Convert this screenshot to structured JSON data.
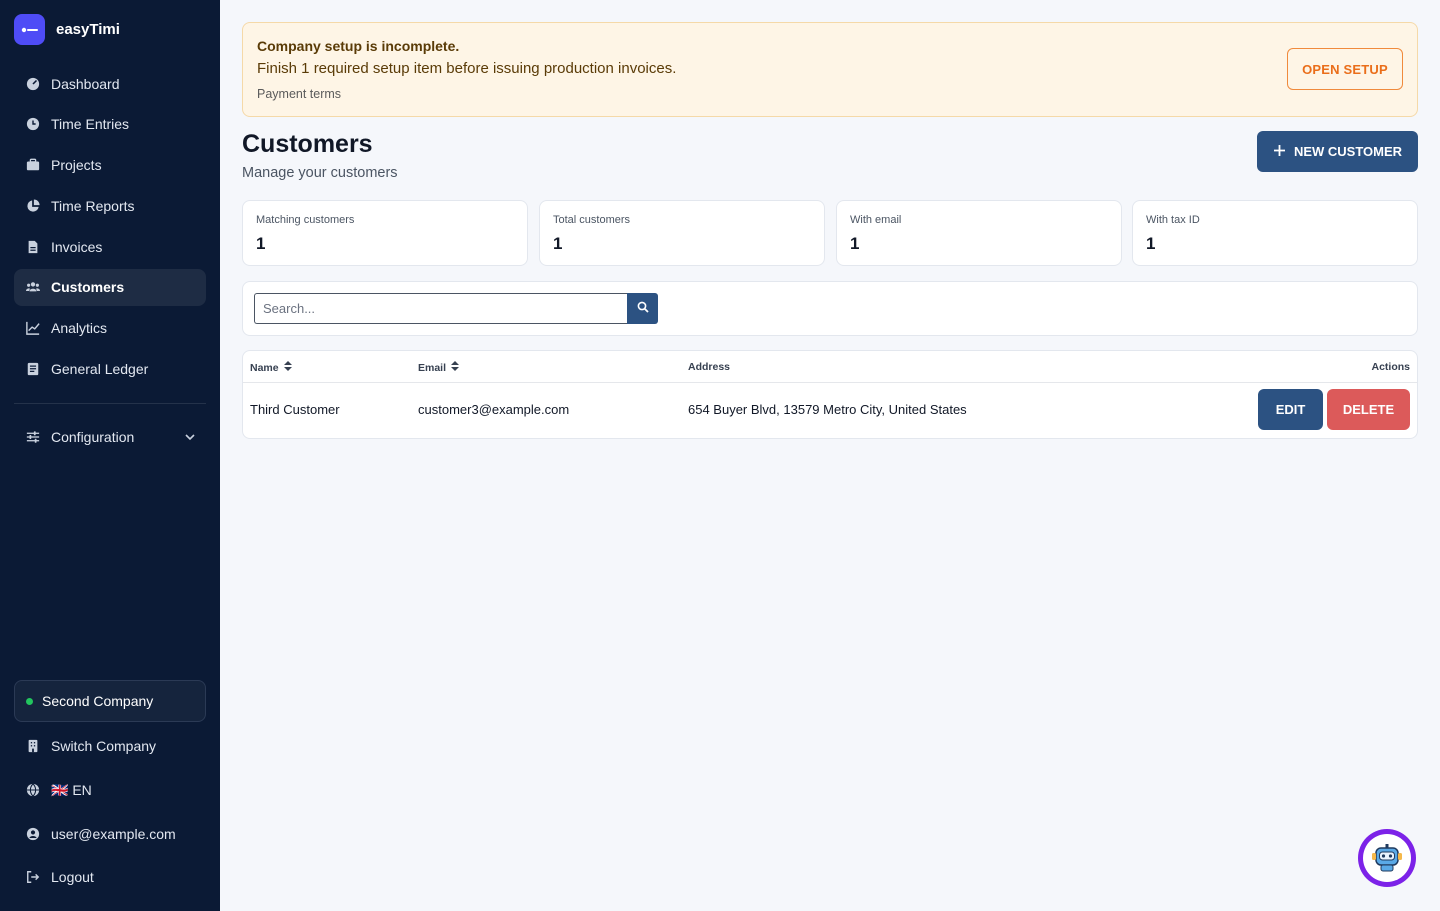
{
  "brand": {
    "name": "easyTimi"
  },
  "nav": {
    "items": [
      {
        "label": "Dashboard",
        "icon": "dashboard-icon",
        "active": false
      },
      {
        "label": "Time Entries",
        "icon": "clock-icon",
        "active": false
      },
      {
        "label": "Projects",
        "icon": "briefcase-icon",
        "active": false
      },
      {
        "label": "Time Reports",
        "icon": "pie-chart-icon",
        "active": false
      },
      {
        "label": "Invoices",
        "icon": "file-icon",
        "active": false
      },
      {
        "label": "Customers",
        "icon": "users-icon",
        "active": true
      },
      {
        "label": "Analytics",
        "icon": "line-chart-icon",
        "active": false
      },
      {
        "label": "General Ledger",
        "icon": "ledger-icon",
        "active": false
      }
    ],
    "configuration": "Configuration"
  },
  "sidebar_bottom": {
    "company": "Second Company",
    "switch_company": "Switch Company",
    "language": "🇬🇧 EN",
    "user": "user@example.com",
    "logout": "Logout"
  },
  "banner": {
    "title": "Company setup is incomplete.",
    "message": "Finish 1 required setup item before issuing production invoices.",
    "item": "Payment terms",
    "button": "OPEN SETUP"
  },
  "page": {
    "title": "Customers",
    "subtitle": "Manage your customers",
    "new_button": "NEW CUSTOMER"
  },
  "stats": [
    {
      "label": "Matching customers",
      "value": "1"
    },
    {
      "label": "Total customers",
      "value": "1"
    },
    {
      "label": "With email",
      "value": "1"
    },
    {
      "label": "With tax ID",
      "value": "1"
    }
  ],
  "search": {
    "placeholder": "Search..."
  },
  "table": {
    "headers": {
      "name": "Name",
      "email": "Email",
      "address": "Address",
      "actions": "Actions"
    },
    "rows": [
      {
        "name": "Third Customer",
        "email": "customer3@example.com",
        "address": "654 Buyer Blvd, 13579 Metro City, United States",
        "edit": "EDIT",
        "delete": "DELETE"
      }
    ]
  },
  "colors": {
    "sidebar": "#0b1a35",
    "primary": "#2c5282",
    "danger": "#dc5a5a",
    "warning_accent": "#ea6e1a",
    "chat_fab": "#7c22e8"
  }
}
